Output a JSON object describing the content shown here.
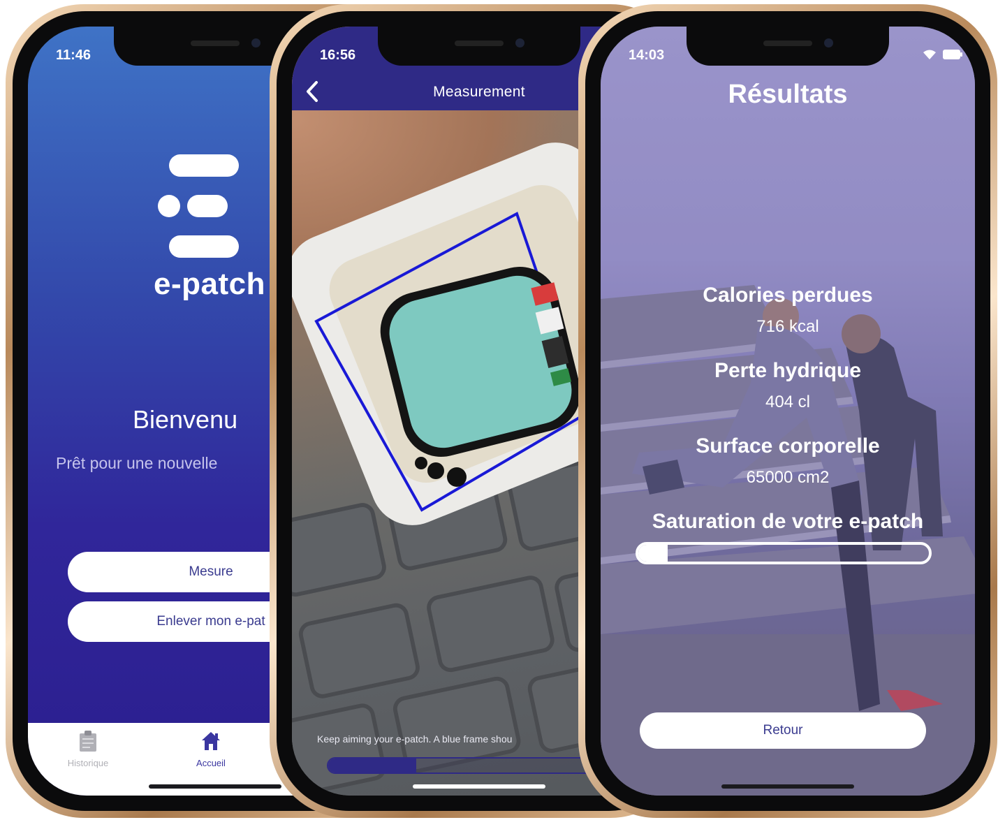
{
  "phone1": {
    "time": "11:46",
    "brand": "e-patch",
    "welcome_title": "Bienvenu",
    "welcome_subtitle": "Prêt pour une nouvelle",
    "buttons": {
      "mesure": "Mesure",
      "enlever": "Enlever mon e-pat"
    },
    "tabs": [
      {
        "label": "Historique",
        "icon": "clipboard-icon"
      },
      {
        "label": "Accueil",
        "icon": "home-icon",
        "active": true
      }
    ]
  },
  "phone2": {
    "time": "16:56",
    "nav_title": "Measurement",
    "hint": "Keep aiming your e-patch. A blue frame shou",
    "progress_fraction": 0.27,
    "colors": {
      "accent": "#2f2a86",
      "frame": "#1919d6"
    }
  },
  "phone3": {
    "time": "14:03",
    "title": "Résultats",
    "metrics": [
      {
        "label": "Calories perdues",
        "value": "716 kcal"
      },
      {
        "label": "Perte hydrique",
        "value": "404 cl"
      },
      {
        "label": "Surface corporelle",
        "value": "65000 cm2"
      }
    ],
    "saturation_label": "Saturation de votre e-patch",
    "saturation_fraction": 0.1,
    "retour": "Retour"
  },
  "colors": {
    "gradient_top": "#3f73c6",
    "gradient_bottom": "#2b1e8e",
    "button_text": "#3a3b8f"
  }
}
